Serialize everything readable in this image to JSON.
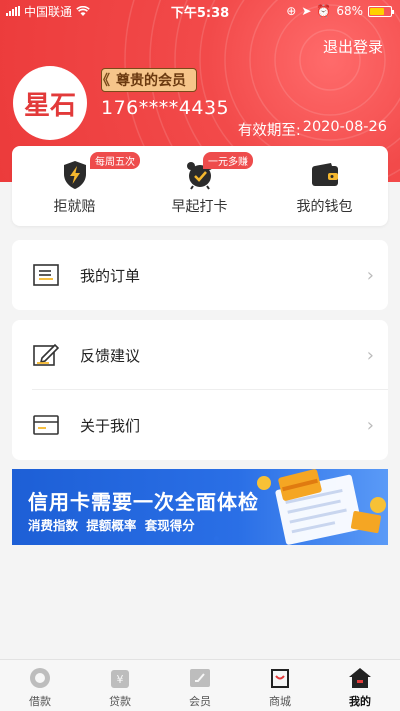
{
  "status_bar": {
    "carrier": "中国联通",
    "time": "下午5:38",
    "battery": "68%",
    "battery_level": 0.68
  },
  "header": {
    "logout_label": "退出登录",
    "avatar_text": "星石",
    "member_label": "尊贵的会员",
    "phone": "176****4435",
    "expiry_label": "有效期至:",
    "expiry_date": "2020-08-26"
  },
  "quick_actions": [
    {
      "label": "拒就赔",
      "tag": "每周五次",
      "icon": "shield-lightning-icon"
    },
    {
      "label": "早起打卡",
      "tag": "一元多赚",
      "icon": "alarm-clock-icon"
    },
    {
      "label": "我的钱包",
      "tag": "",
      "icon": "wallet-icon"
    }
  ],
  "menu": {
    "orders_label": "我的订单",
    "feedback_label": "反馈建议",
    "about_label": "关于我们"
  },
  "banner": {
    "title": "信用卡需要一次全面体检",
    "subtitle": "消费指数  提额概率  套现得分"
  },
  "tabs": [
    {
      "label": "借款",
      "icon": "loan-icon"
    },
    {
      "label": "贷款",
      "icon": "money-bag-icon"
    },
    {
      "label": "会员",
      "icon": "member-card-icon"
    },
    {
      "label": "商城",
      "icon": "shopping-bag-icon"
    },
    {
      "label": "我的",
      "icon": "home-icon"
    }
  ],
  "colors": {
    "header_red": "#ec3b3b",
    "badge_gold": "#f6c58a",
    "tag_red": "#ee4c4c",
    "banner_blue": "#2a6fe6"
  }
}
